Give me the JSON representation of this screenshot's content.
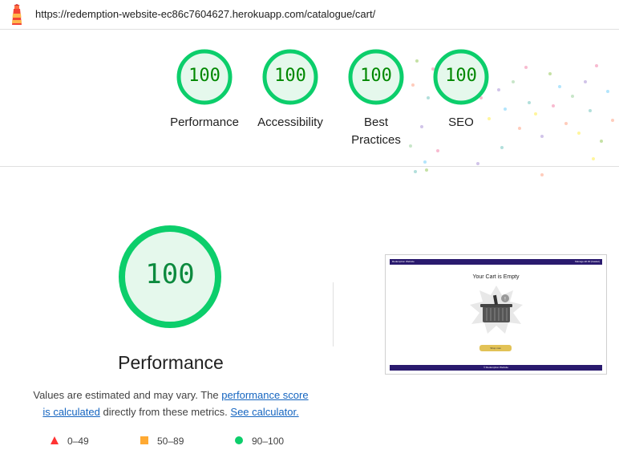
{
  "browser": {
    "url": "https://redemption-website-ec86c7604627.herokuapp.com/catalogue/cart/",
    "icon": "lighthouse-icon"
  },
  "summary": {
    "gauges": [
      {
        "score": "100",
        "label": "Performance"
      },
      {
        "score": "100",
        "label": "Accessibility"
      },
      {
        "score": "100",
        "label_line1": "Best",
        "label_line2": "Practices"
      },
      {
        "score": "100",
        "label": "SEO"
      }
    ]
  },
  "performance": {
    "score": "100",
    "title": "Performance",
    "desc_1": "Values are estimated and may vary. The ",
    "link_score": "performance score is calculated",
    "link_score_a": "performance score",
    "link_score_b": "is calculated",
    "desc_2": " directly from these metrics. ",
    "link_calc": "See calculator."
  },
  "legend": [
    {
      "range": "0–49",
      "color": "#ff3333"
    },
    {
      "range": "50–89",
      "color": "#ffaa33"
    },
    {
      "range": "90–100",
      "color": "#0cce6b"
    }
  ],
  "screenshot": {
    "nav_left": "Redemption Website",
    "nav_right": "Manage  £0.00 (basket)",
    "title": "Your Cart is Empty",
    "button": "Shop now",
    "footer": "© Redemption Website"
  },
  "colors": {
    "pass_green": "#0cce6b",
    "pass_fill": "#e5f8ec",
    "score_text": "#008800",
    "link": "#1565c0",
    "nav_purple": "#2a1a6e"
  }
}
